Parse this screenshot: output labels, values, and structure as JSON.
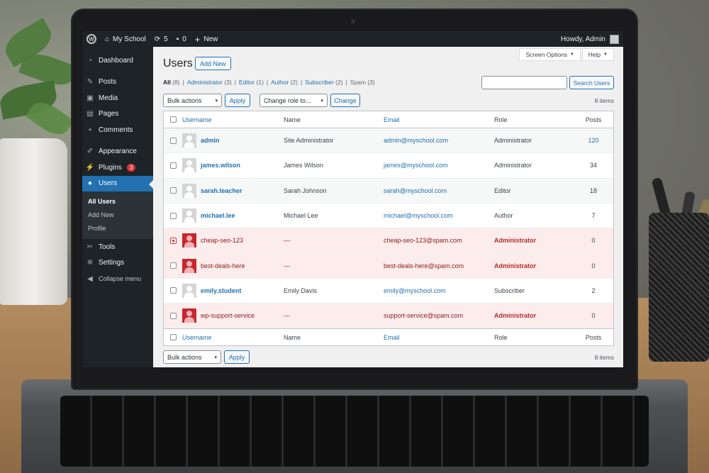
{
  "adminbar": {
    "site_name": "My School",
    "updates_count": "5",
    "comments_count": "0",
    "new_label": "New",
    "greeting": "Howdy, Admin"
  },
  "sidebar": {
    "items": [
      {
        "label": "Dashboard",
        "icon": "dashboard-icon"
      },
      {
        "label": "Posts",
        "icon": "pin-icon"
      },
      {
        "label": "Media",
        "icon": "media-icon"
      },
      {
        "label": "Pages",
        "icon": "pages-icon"
      },
      {
        "label": "Comments",
        "icon": "comment-icon"
      },
      {
        "label": "Appearance",
        "icon": "brush-icon"
      },
      {
        "label": "Plugins",
        "icon": "plugin-icon",
        "badge": "3"
      },
      {
        "label": "Users",
        "icon": "user-icon"
      },
      {
        "label": "Tools",
        "icon": "wrench-icon"
      },
      {
        "label": "Settings",
        "icon": "settings-icon"
      },
      {
        "label": "Collapse menu",
        "icon": "collapse-icon"
      }
    ],
    "users_submenu": [
      "All Users",
      "Add New",
      "Profile"
    ]
  },
  "header": {
    "screen_options": "Screen Options",
    "help": "Help",
    "title": "Users",
    "add_new": "Add New"
  },
  "filters": {
    "all": "All",
    "all_count": "(8)",
    "administrator": "Administrator",
    "administrator_count": "(3)",
    "editor": "Editor",
    "editor_count": "(1)",
    "author": "Author",
    "author_count": "(2)",
    "subscriber": "Subscriber",
    "subscriber_count": "(2)",
    "spam": "Spam",
    "spam_count": "(3)"
  },
  "search": {
    "value": "",
    "button": "Search Users"
  },
  "actions": {
    "bulk": "Bulk actions",
    "apply": "Apply",
    "change_role": "Change role to...",
    "change": "Change",
    "items_count": "8 items"
  },
  "table": {
    "columns": [
      "Username",
      "Name",
      "Email",
      "Role",
      "Posts"
    ],
    "rows": [
      {
        "username": "admin",
        "name": "Site Administrator",
        "email": "admin@myschool.com",
        "role": "Administrator",
        "posts": "120",
        "spam": false,
        "checked": false
      },
      {
        "username": "james.wilson",
        "name": "James Wilson",
        "email": "james@myschool.com",
        "role": "Administrator",
        "posts": "34",
        "spam": false,
        "checked": false
      },
      {
        "username": "sarah.teacher",
        "name": "Sarah Johnson",
        "email": "sarah@myschool.com",
        "role": "Editor",
        "posts": "18",
        "spam": false,
        "checked": false
      },
      {
        "username": "michael.lee",
        "name": "Michael Lee",
        "email": "michael@myschool.com",
        "role": "Author",
        "posts": "7",
        "spam": false,
        "checked": false
      },
      {
        "username": "cheap-seo-123",
        "name": "—",
        "email": "cheap-seo-123@spam.com",
        "role": "Administrator",
        "posts": "0",
        "spam": true,
        "checked": true
      },
      {
        "username": "best-deals-here",
        "name": "—",
        "email": "best-deals-here@spam.com",
        "role": "Administrator",
        "posts": "0",
        "spam": true,
        "checked": false
      },
      {
        "username": "emily.student",
        "name": "Emily Davis",
        "email": "emily@myschool.com",
        "role": "Subscriber",
        "posts": "2",
        "spam": false,
        "checked": false
      },
      {
        "username": "wp-support-service",
        "name": "—",
        "email": "support-service@spam.com",
        "role": "Administrator",
        "posts": "0",
        "spam": true,
        "checked": false
      }
    ]
  },
  "colors": {
    "accent": "#2271b1",
    "adminbar": "#1d2327",
    "spam_row": "#fcecec",
    "danger": "#d63638"
  }
}
